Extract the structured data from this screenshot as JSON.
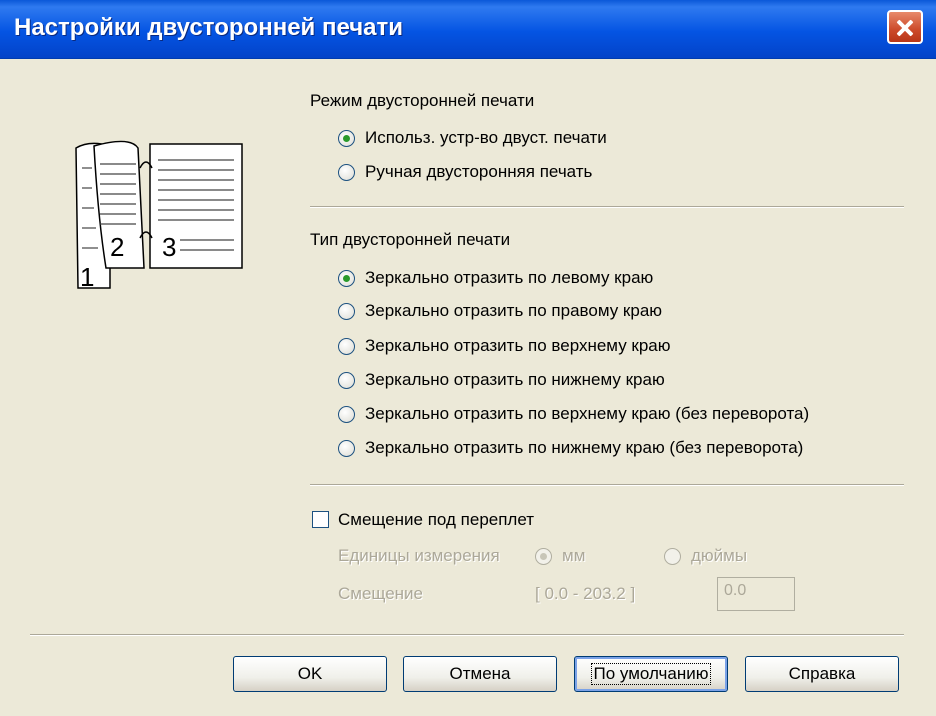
{
  "window": {
    "title": "Настройки двусторонней печати"
  },
  "illustration": {
    "page_numbers": [
      "1",
      "2",
      "3"
    ]
  },
  "duplex_mode": {
    "label": "Режим двусторонней печати",
    "options": [
      {
        "label": "Использ. устр-во двуст. печати",
        "checked": true
      },
      {
        "label": "Ручная двусторонняя печать",
        "checked": false
      }
    ]
  },
  "duplex_type": {
    "label": "Тип двусторонней печати",
    "options": [
      {
        "label": "Зеркально отразить по левому краю",
        "checked": true
      },
      {
        "label": "Зеркально отразить по правому краю",
        "checked": false
      },
      {
        "label": "Зеркально отразить по верхнему краю",
        "checked": false
      },
      {
        "label": "Зеркально отразить по нижнему краю",
        "checked": false
      },
      {
        "label": "Зеркально отразить по верхнему краю (без переворота)",
        "checked": false
      },
      {
        "label": "Зеркально отразить по нижнему краю (без переворота)",
        "checked": false
      }
    ]
  },
  "binding_offset": {
    "checkbox_label": "Смещение под переплет",
    "checked": false,
    "units_label": "Единицы измерения",
    "unit_mm": "мм",
    "unit_inches": "дюймы",
    "offset_label": "Смещение",
    "range": "[ 0.0 - 203.2 ]",
    "value": "0.0"
  },
  "buttons": {
    "ok": "OK",
    "cancel": "Отмена",
    "default": "По умолчанию",
    "help": "Справка"
  }
}
